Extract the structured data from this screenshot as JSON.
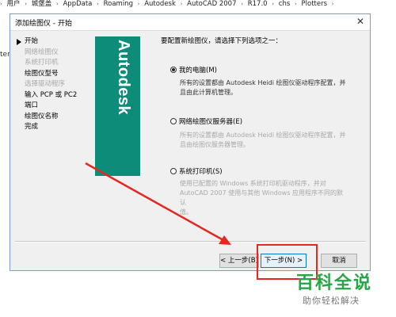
{
  "breadcrumb": {
    "items": [
      "用户",
      "城堡盖",
      "AppData",
      "Roaming",
      "Autodesk",
      "AutoCAD 2007",
      "R17.0",
      "chs",
      "Plotters"
    ]
  },
  "side_text": "tem",
  "dialog": {
    "title": "添加绘图仪 - 开始",
    "nav_items": [
      {
        "label": "开始",
        "state": "active"
      },
      {
        "label": "网络绘图仪",
        "state": "disabled"
      },
      {
        "label": "系统打印机",
        "state": "disabled"
      },
      {
        "label": "绘图仪型号",
        "state": "normal"
      },
      {
        "label": "选择驱动程序",
        "state": "disabled"
      },
      {
        "label": "输入 PCP 或 PC2",
        "state": "normal"
      },
      {
        "label": "端口",
        "state": "normal"
      },
      {
        "label": "绘图仪名称",
        "state": "normal"
      },
      {
        "label": "完成",
        "state": "normal"
      }
    ],
    "brand": "Autodesk",
    "brand_color": "#0e8c7a",
    "question": "要配置新绘图仪，请选择下列选项之一：",
    "options": [
      {
        "label": "我的电脑(M)",
        "checked": true,
        "desc": [
          "所有的设置都由 Autodesk Heidi 绘图仪驱动程序配置，并",
          "且由此计算机管理。"
        ]
      },
      {
        "label": "网络绘图仪服务器(E)",
        "checked": false,
        "desc": [
          "所有的设置都由 Autodesk Heidi 绘图仪驱动程序配置，并",
          "且由绘图仪服务器管理。"
        ]
      },
      {
        "label": "系统打印机(S)",
        "checked": false,
        "desc": [
          "使用已配置的 Windows 系统打印机驱动程序，并对",
          "AutoCAD 2007 使用与其他 Windows 应用程序不同的默认",
          "值。"
        ]
      }
    ],
    "buttons": {
      "back": "< 上一步(B)",
      "next": "下一步(N) >",
      "cancel": "取消"
    }
  },
  "annotation_color": "#e8261f",
  "watermark": {
    "main": "百科全说",
    "sub": "助你轻松解决"
  }
}
